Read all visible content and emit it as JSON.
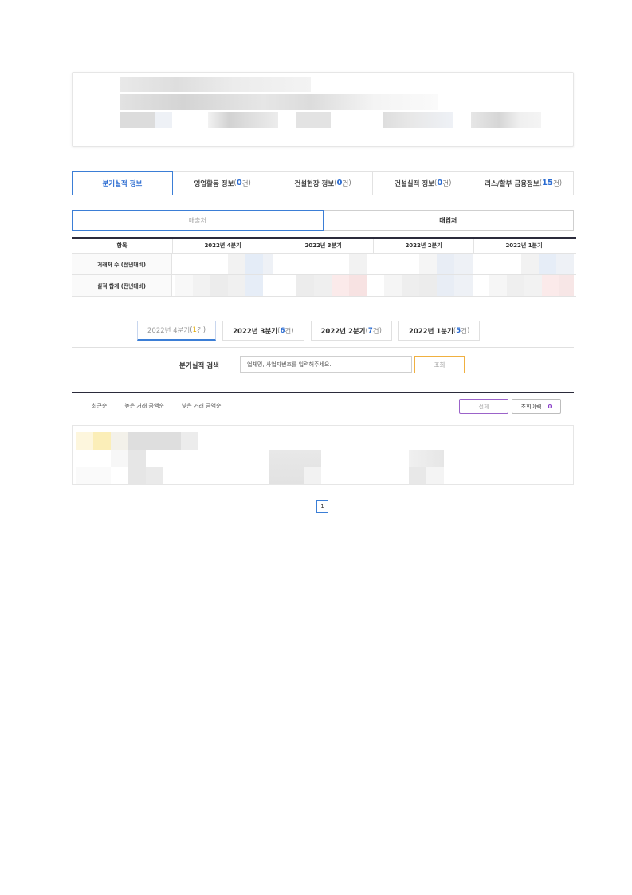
{
  "main_tabs": [
    {
      "label": "분기실적 정보",
      "count": "",
      "active": true
    },
    {
      "label": "영업활동 정보 ",
      "count": "0",
      "suffix": "건"
    },
    {
      "label": "건설현장 정보 ",
      "count": "0",
      "suffix": "건"
    },
    {
      "label": "건설실적 정보 ",
      "count": "0",
      "suffix": "건"
    },
    {
      "label": "리스/할부 금융정보 ",
      "count": "15",
      "suffix": "건"
    }
  ],
  "sub_toggle": {
    "sales": "매출처",
    "purchase": "매입처"
  },
  "quarter_table": {
    "headers": [
      "항목",
      "2022년 4분기",
      "2022년 3분기",
      "2022년 2분기",
      "2022년 1분기"
    ],
    "rows": [
      "거래처 수 (전년대비)",
      "실적 합계 (전년대비)"
    ]
  },
  "quarter_tabs": [
    {
      "prefix": "2022년 4분기 ",
      "count": "1",
      "suffix": "건"
    },
    {
      "prefix": "2022년 3분기 ",
      "count": "6",
      "suffix": "건"
    },
    {
      "prefix": "2022년 2분기 ",
      "count": "7",
      "suffix": "건"
    },
    {
      "prefix": "2022년 1분기 ",
      "count": "5",
      "suffix": "건"
    }
  ],
  "search": {
    "label": "분기실적 검색",
    "placeholder": "업체명, 사업자번호를 입력해주세요.",
    "button": "조회"
  },
  "sort": {
    "recent": "최근순",
    "high_amount": "높은 거래 금액순",
    "low_amount": "낮은 거래 금액순",
    "all_button": "전체",
    "history_button": "조회이력",
    "history_count": "0"
  },
  "pagination": {
    "current": "1"
  },
  "colors": {
    "accent_blue": "#3b7ed6",
    "accent_orange": "#f0b040",
    "accent_purple": "#9b63c9",
    "dark_rule": "#2b2b3b"
  }
}
